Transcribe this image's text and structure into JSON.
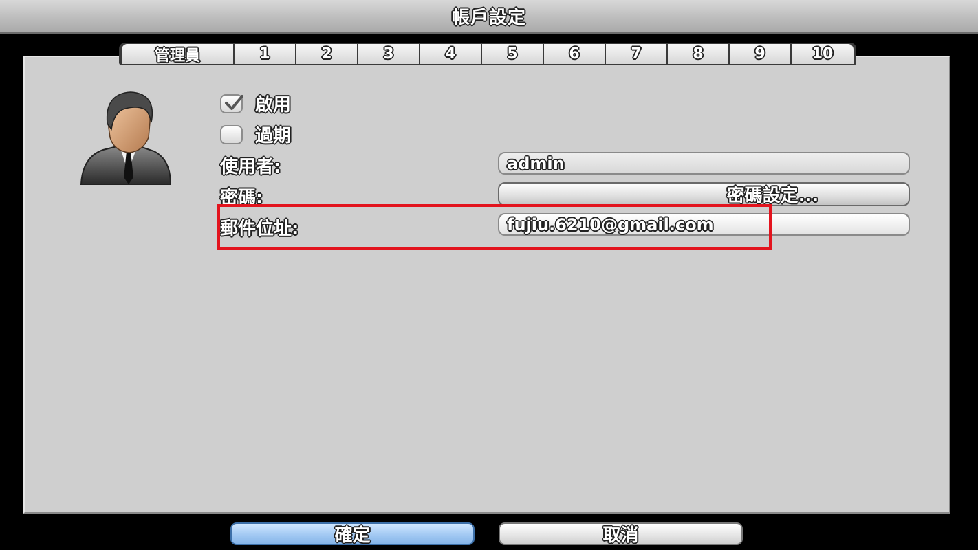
{
  "window": {
    "title": "帳戶設定"
  },
  "tabs": [
    {
      "label": "管理員",
      "selected": true
    },
    {
      "label": "1"
    },
    {
      "label": "2"
    },
    {
      "label": "3"
    },
    {
      "label": "4"
    },
    {
      "label": "5"
    },
    {
      "label": "6"
    },
    {
      "label": "7"
    },
    {
      "label": "8"
    },
    {
      "label": "9"
    },
    {
      "label": "10"
    }
  ],
  "avatar": {
    "icon": "user-avatar-icon"
  },
  "form": {
    "enable": {
      "label": "啟用",
      "checked": true
    },
    "expire": {
      "label": "過期",
      "checked": false
    },
    "user": {
      "label": "使用者:",
      "value": "admin"
    },
    "password": {
      "label": "密碼:",
      "button_label": "密碼設定..."
    },
    "email": {
      "label": "郵件位址:",
      "value": "fujiu.6210@gmail.com"
    }
  },
  "buttons": {
    "ok": "確定",
    "cancel": "取消"
  },
  "colors": {
    "highlight": "#e3141e",
    "ok_button": "#9fc7f2"
  }
}
